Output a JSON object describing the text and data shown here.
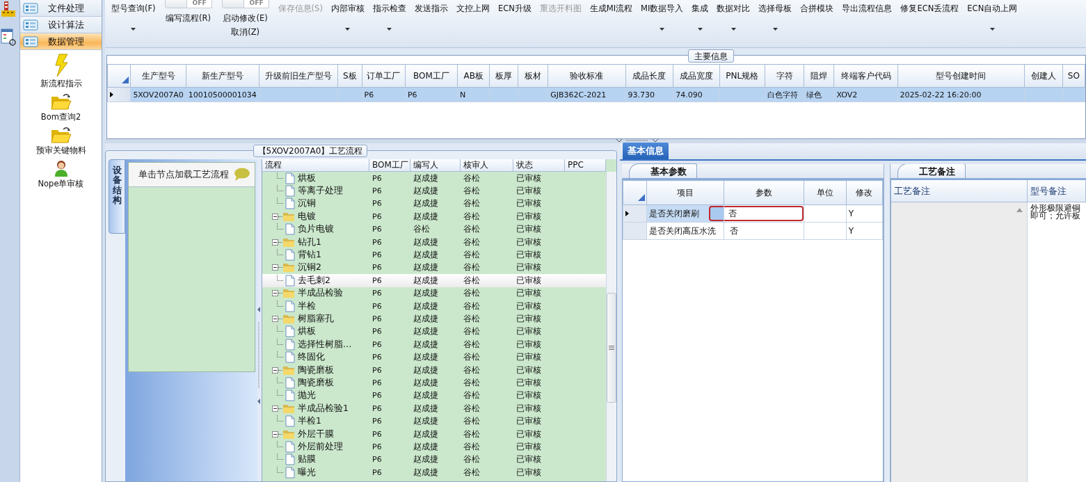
{
  "sidebar": {
    "nav": [
      {
        "label": "文件处理",
        "selected": false
      },
      {
        "label": "设计算法",
        "selected": false
      },
      {
        "label": "数据管理",
        "selected": true
      }
    ],
    "tools": [
      {
        "label": "新流程指示"
      },
      {
        "label": "Bom查询2"
      },
      {
        "label": "预审关键物料"
      },
      {
        "label": "Nope单审核"
      }
    ]
  },
  "toolbar": [
    {
      "kind": "button",
      "label": "型号查询(F)",
      "menu": true,
      "disabled": false
    },
    {
      "kind": "toggle",
      "switch": "OFF",
      "on": false,
      "label": "编写流程(R)"
    },
    {
      "kind": "toggle",
      "switch": "OFF",
      "on": false,
      "label": "启动修改(E)",
      "label2": "取消(Z)"
    },
    {
      "kind": "button",
      "label": "保存信息(S)",
      "menu": false,
      "disabled": true
    },
    {
      "kind": "button",
      "label": "内部审核",
      "menu": true,
      "disabled": false
    },
    {
      "kind": "button",
      "label": "指示检查",
      "menu": true,
      "disabled": false
    },
    {
      "kind": "button",
      "label": "发送指示",
      "menu": false,
      "disabled": false
    },
    {
      "kind": "button",
      "label": "文控上网",
      "menu": false,
      "disabled": false
    },
    {
      "kind": "button",
      "label": "ECN升级",
      "menu": false,
      "disabled": false
    },
    {
      "kind": "button",
      "label": "重选开料图",
      "menu": false,
      "disabled": true
    },
    {
      "kind": "button",
      "label": "生成MI流程",
      "menu": false,
      "disabled": false
    },
    {
      "kind": "button",
      "label": "MI数据导入",
      "menu": true,
      "disabled": false
    },
    {
      "kind": "button",
      "label": "集成",
      "menu": true,
      "disabled": false
    },
    {
      "kind": "button",
      "label": "数据对比",
      "menu": true,
      "disabled": false
    },
    {
      "kind": "button",
      "label": "选择母板",
      "menu": true,
      "disabled": false
    },
    {
      "kind": "button",
      "label": "合拼模块",
      "menu": false,
      "disabled": false
    },
    {
      "kind": "button",
      "label": "导出流程信息",
      "menu": false,
      "disabled": false
    },
    {
      "kind": "button",
      "label": "修复ECN丢流程",
      "menu": false,
      "disabled": false
    },
    {
      "kind": "button",
      "label": "ECN自动上网",
      "menu": true,
      "disabled": false
    }
  ],
  "main_info": {
    "title": "主要信息",
    "columns": [
      "生产型号",
      "新生产型号",
      "升级前旧生产型号",
      "S板",
      "订单工厂",
      "BOM工厂",
      "AB板",
      "板厚",
      "板材",
      "验收标准",
      "成品长度",
      "成品宽度",
      "PNL规格",
      "字符",
      "阻焊",
      "终端客户代码",
      "型号创建时间",
      "创建人",
      "SO"
    ],
    "rows": [
      {
        "selected": true,
        "cells": [
          "5XOV2007A0",
          "10010500001034",
          null,
          null,
          "P6",
          "P6",
          "N",
          null,
          null,
          "GJB362C-2021",
          "93.730",
          "74.090",
          null,
          "白色字符",
          "绿色",
          "XOV2",
          "2025-02-22 16:20:00",
          null,
          null
        ]
      }
    ]
  },
  "process": {
    "title": "【5XOV2007A0】工艺流程",
    "side_tab": "设备结构",
    "hint": "单击节点加载工艺流程",
    "columns": [
      "流程",
      "BOM工厂",
      "编写人",
      "核审人",
      "状态",
      "PPC"
    ],
    "tree": [
      {
        "children": [
          {
            "label": "烘板",
            "selected": false,
            "cells": [
              "P6",
              "赵成捷",
              "谷松",
              "已审核"
            ]
          },
          {
            "label": "等离子处理",
            "selected": false,
            "cells": [
              "P6",
              "赵成捷",
              "谷松",
              "已审核"
            ]
          },
          {
            "label": "沉铜",
            "selected": false,
            "cells": [
              "P6",
              "赵成捷",
              "谷松",
              "已审核"
            ]
          }
        ]
      },
      {
        "label": "电镀",
        "expanded": true,
        "selected": false,
        "cells": [
          "P6",
          "赵成捷",
          "谷松",
          "已审核"
        ],
        "children": [
          {
            "label": "负片电镀",
            "selected": false,
            "cells": [
              "P6",
              "谷松",
              "谷松",
              "已审核"
            ]
          }
        ]
      },
      {
        "label": "钻孔1",
        "expanded": true,
        "selected": false,
        "cells": [
          "P6",
          "赵成捷",
          "谷松",
          "已审核"
        ],
        "children": [
          {
            "label": "背钻1",
            "selected": false,
            "cells": [
              "P6",
              "赵成捷",
              "谷松",
              "已审核"
            ]
          }
        ]
      },
      {
        "label": "沉铜2",
        "expanded": true,
        "selected": false,
        "cells": [
          "P6",
          "赵成捷",
          "谷松",
          "已审核"
        ],
        "children": [
          {
            "label": "去毛刺2",
            "selected": true,
            "cells": [
              "P6",
              "赵成捷",
              "谷松",
              "已审核"
            ]
          }
        ]
      },
      {
        "label": "半成品检验",
        "expanded": true,
        "selected": false,
        "cells": [
          "P6",
          "赵成捷",
          "谷松",
          "已审核"
        ],
        "children": [
          {
            "label": "半检",
            "selected": false,
            "cells": [
              "P6",
              "赵成捷",
              "谷松",
              "已审核"
            ]
          }
        ]
      },
      {
        "label": "树脂塞孔",
        "expanded": true,
        "selected": false,
        "cells": [
          "P6",
          "赵成捷",
          "谷松",
          "已审核"
        ],
        "children": [
          {
            "label": "烘板",
            "selected": false,
            "cells": [
              "P6",
              "赵成捷",
              "谷松",
              "已审核"
            ]
          },
          {
            "label": "选择性树脂…",
            "selected": false,
            "cells": [
              "P6",
              "赵成捷",
              "谷松",
              "已审核"
            ]
          },
          {
            "label": "终固化",
            "selected": false,
            "cells": [
              "P6",
              "赵成捷",
              "谷松",
              "已审核"
            ]
          }
        ]
      },
      {
        "label": "陶瓷磨板",
        "expanded": true,
        "selected": false,
        "cells": [
          "P6",
          "赵成捷",
          "谷松",
          "已审核"
        ],
        "children": [
          {
            "label": "陶瓷磨板",
            "selected": false,
            "cells": [
              "P6",
              "赵成捷",
              "谷松",
              "已审核"
            ]
          },
          {
            "label": "抛光",
            "selected": false,
            "cells": [
              "P6",
              "赵成捷",
              "谷松",
              "已审核"
            ]
          }
        ]
      },
      {
        "label": "半成品检验1",
        "expanded": true,
        "selected": false,
        "cells": [
          "P6",
          "赵成捷",
          "谷松",
          "已审核"
        ],
        "children": [
          {
            "label": "半检1",
            "selected": false,
            "cells": [
              "P6",
              "赵成捷",
              "谷松",
              "已审核"
            ]
          }
        ]
      },
      {
        "label": "外层干膜",
        "expanded": true,
        "selected": false,
        "cells": [
          "P6",
          "赵成捷",
          "谷松",
          "已审核"
        ],
        "children": [
          {
            "label": "外层前处理",
            "selected": false,
            "cells": [
              "P6",
              "赵成捷",
              "谷松",
              "已审核"
            ]
          },
          {
            "label": "贴膜",
            "selected": false,
            "cells": [
              "P6",
              "赵成捷",
              "谷松",
              "已审核"
            ]
          },
          {
            "label": "曝光",
            "selected": false,
            "cells": [
              "P6",
              "赵成捷",
              "谷松",
              "已审核"
            ]
          }
        ]
      }
    ]
  },
  "basic_info": {
    "tab": "基本信息",
    "params": {
      "tab": "基本参数",
      "columns": [
        "项目",
        "参数",
        "单位",
        "修改"
      ],
      "rows": [
        {
          "selected": true,
          "editing": true,
          "cells": [
            "是否关闭磨刷",
            "否",
            null,
            "Y"
          ]
        },
        {
          "selected": false,
          "editing": false,
          "cells": [
            "是否关闭高压水洗",
            "否",
            null,
            "Y"
          ]
        }
      ]
    },
    "notes": {
      "tab": "工艺备注",
      "columns": [
        "工艺备注",
        "型号备注"
      ],
      "lines": [
        "外形极限避铜",
        "即可；允许板"
      ]
    }
  }
}
